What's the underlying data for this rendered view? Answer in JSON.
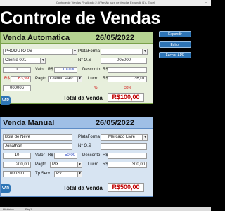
{
  "window": {
    "title": "Controle de Vendas Finalizado 2.0(Versão para de Vendas Expandir (1) - Excel",
    "minimize_glyph": "–"
  },
  "page_title": "Controle de Vendas",
  "side_buttons": [
    "Expandir",
    "Editor",
    "Fechar APP"
  ],
  "automatic": {
    "title": "Venda Automatica",
    "date": "26/05/2022",
    "produto": "PRODUTO 06",
    "cliente": "Cliente 001",
    "plataforma_label": "PlataForma",
    "plataforma_value": "",
    "nos_label": "N° O.S",
    "nos_value": "005000",
    "qtd": "1",
    "valor_label": "Valor",
    "valor_currency": "R$",
    "valor_value": "100,00",
    "desconto_label": "Desconto",
    "desconto_currency": "R$",
    "desconto_value": "",
    "cost_currency": "R$",
    "cost_value": "63,99",
    "pagto_label": "Pagto",
    "pagto_value": "Credito.Parc",
    "lucro_label": "Lucro",
    "lucro_currency": "R$",
    "lucro_value": "36,01",
    "pct_left": "%",
    "pct_right": "36%",
    "code": "000006",
    "total_label": "Total da Venda",
    "total_value": "R$100,00",
    "button_label": "VAR"
  },
  "manual": {
    "title": "Venda Manual",
    "date": "26/05/2022",
    "produto": "Bola de Neve",
    "cliente": "Jonathan",
    "plataforma_label": "PlataForma",
    "plataforma_value": "Mercado Livre",
    "nos_label": "N° O.S",
    "nos_value": "",
    "qtd": "10",
    "valor_label": "Valor",
    "valor_currency": "R$",
    "valor_value": "50,00",
    "desconto_label": "Desconto",
    "desconto_currency": "R$",
    "desconto_value": "",
    "cost_value": "200,00",
    "pagto_label": "Pagto",
    "pagto_value": "PIX",
    "lucro_label": "Lucro",
    "lucro_currency": "R$",
    "lucro_value": "300,00",
    "code": "000200",
    "tpserv_label": "Tp Serv",
    "tpserv_value": "PV",
    "total_label": "Total da Venda",
    "total_value": "R$500,00",
    "button_label": "VAR"
  },
  "sheet_tabs": [
    "Histórico",
    "Pág1"
  ]
}
